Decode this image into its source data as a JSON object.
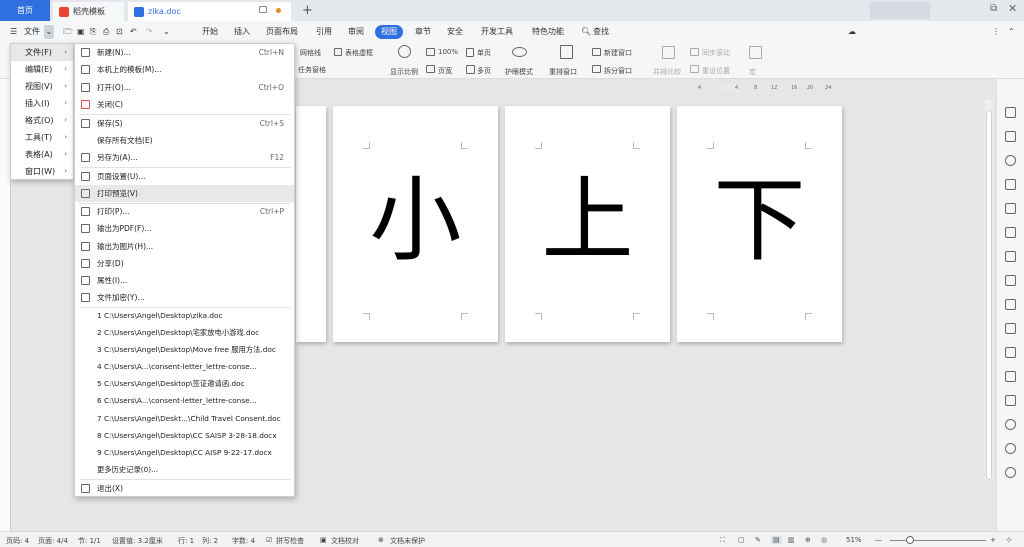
{
  "tabs": {
    "home": "首页",
    "docer": "稻壳模板",
    "doc": "zika.doc"
  },
  "menubar": {
    "file_label": "文件",
    "tabs": [
      "开始",
      "插入",
      "页面布局",
      "引用",
      "审阅",
      "视图",
      "章节",
      "安全",
      "开发工具",
      "特色功能"
    ],
    "active_tab": "视图",
    "search_label": "查找"
  },
  "ribbon": {
    "outline": "网格线",
    "table_border": "表格虚框",
    "task_pane": "任务窗格",
    "zoom_100": "100%",
    "single_page": "单页",
    "show_ratio": "显示比例",
    "page_width": "页宽",
    "multi_page": "多页",
    "eye_mode": "护眼模式",
    "arrange_window": "重排窗口",
    "new_window": "新建窗口",
    "split_window": "拆分窗口",
    "side_by_side": "并排比较",
    "sync_scroll": "同步滚动",
    "reset_pos": "重设位置",
    "macro": "宏"
  },
  "ruler_ticks": [
    "4",
    "4",
    "8",
    "12",
    "16",
    "20",
    "24"
  ],
  "menu_main": [
    {
      "label": "文件(F)"
    },
    {
      "label": "编辑(E)"
    },
    {
      "label": "视图(V)"
    },
    {
      "label": "插入(I)"
    },
    {
      "label": "格式(O)"
    },
    {
      "label": "工具(T)"
    },
    {
      "label": "表格(A)"
    },
    {
      "label": "窗口(W)"
    }
  ],
  "menu_file": [
    {
      "label": "新建(N)...",
      "shortcut": "Ctrl+N"
    },
    {
      "label": "本机上的模板(M)...",
      "shortcut": ""
    },
    {
      "label": "打开(O)...",
      "shortcut": "Ctrl+O"
    },
    {
      "label": "关闭(C)",
      "shortcut": ""
    },
    {
      "label": "保存(S)",
      "shortcut": "Ctrl+S"
    },
    {
      "label": "保存所有文档(E)",
      "shortcut": ""
    },
    {
      "label": "另存为(A)...",
      "shortcut": "F12"
    },
    {
      "label": "页面设置(U)...",
      "shortcut": ""
    },
    {
      "label": "打印预览(V)",
      "shortcut": ""
    },
    {
      "label": "打印(P)...",
      "shortcut": "Ctrl+P"
    },
    {
      "label": "输出为PDF(F)...",
      "shortcut": ""
    },
    {
      "label": "输出为图片(H)...",
      "shortcut": ""
    },
    {
      "label": "分享(D)",
      "shortcut": ""
    },
    {
      "label": "属性(I)...",
      "shortcut": ""
    },
    {
      "label": "文件加密(Y)...",
      "shortcut": ""
    }
  ],
  "recent_files": [
    "1 C:\\Users\\Angel\\Desktop\\zika.doc",
    "2 C:\\Users\\Angel\\Desktop\\宅家放电小游戏.doc",
    "3 C:\\Users\\Angel\\Desktop\\Move free 服用方法.doc",
    "4 C:\\Users\\A...\\consent-letter_lettre-conse...",
    "5 C:\\Users\\Angel\\Desktop\\签证邀请函.doc",
    "6 C:\\Users\\A...\\consent-letter_lettre-conse...",
    "7 C:\\Users\\Angel\\Deskt...\\Child Travel Consent.doc",
    "8 C:\\Users\\Angel\\Desktop\\CC SAISP 3-28-18.docx",
    "9 C:\\Users\\Angel\\Desktop\\CC AISP 9-22-17.docx"
  ],
  "more_history": "更多历史记录(0)...",
  "exit_label": "退出(X)",
  "pages": [
    "小",
    "上",
    "下"
  ],
  "status": {
    "page": "页码: 4",
    "pages": "页面: 4/4",
    "section": "节: 1/1",
    "setting": "设置值: 3.2厘米",
    "row": "行: 1",
    "col": "列: 2",
    "chars": "字数: 4",
    "spell": "拼写检查",
    "proof": "文档校对",
    "protect": "文档未保护",
    "zoom": "51%"
  },
  "colors": {
    "accent": "#2f6fe0"
  }
}
